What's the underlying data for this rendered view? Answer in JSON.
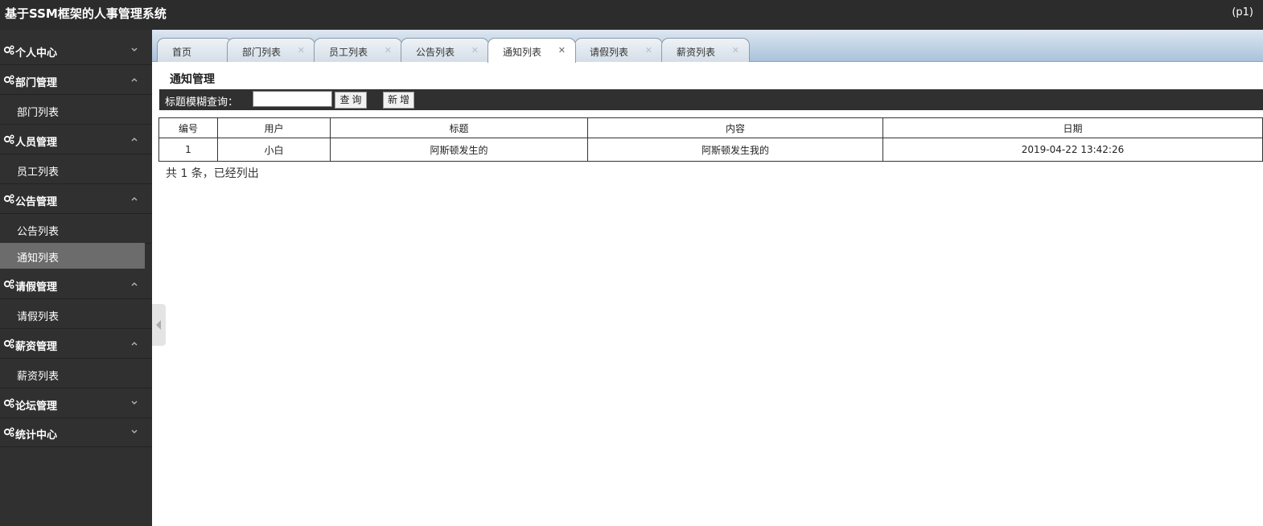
{
  "header": {
    "title": "基于SSM框架的人事管理系统",
    "user": "(p1)"
  },
  "sidebar": {
    "groups": [
      {
        "label": "个人中心"
      },
      {
        "label": "部门管理",
        "items": [
          "部门列表"
        ]
      },
      {
        "label": "人员管理",
        "items": [
          "员工列表"
        ]
      },
      {
        "label": "公告管理",
        "items": [
          "公告列表",
          "通知列表"
        ]
      },
      {
        "label": "请假管理",
        "items": [
          "请假列表"
        ]
      },
      {
        "label": "薪资管理",
        "items": [
          "薪资列表"
        ]
      },
      {
        "label": "论坛管理"
      },
      {
        "label": "统计中心"
      }
    ],
    "active_item": "通知列表"
  },
  "tabs": [
    {
      "label": "首页",
      "closable": false
    },
    {
      "label": "部门列表",
      "closable": true
    },
    {
      "label": "员工列表",
      "closable": true
    },
    {
      "label": "公告列表",
      "closable": true
    },
    {
      "label": "通知列表",
      "closable": true,
      "active": true
    },
    {
      "label": "请假列表",
      "closable": true
    },
    {
      "label": "薪资列表",
      "closable": true
    }
  ],
  "main": {
    "section_title": "通知管理",
    "search": {
      "label": "标题模糊查询：",
      "value": "",
      "query_button": "查询",
      "add_button": "新增"
    },
    "table": {
      "columns": [
        "编号",
        "用户",
        "标题",
        "内容",
        "日期"
      ],
      "rows": [
        [
          "1",
          "小白",
          "阿斯顿发生的",
          "阿斯顿发生我的",
          "2019-04-22 13:42:26"
        ]
      ]
    },
    "footer": "共 1 条，已经列出"
  }
}
